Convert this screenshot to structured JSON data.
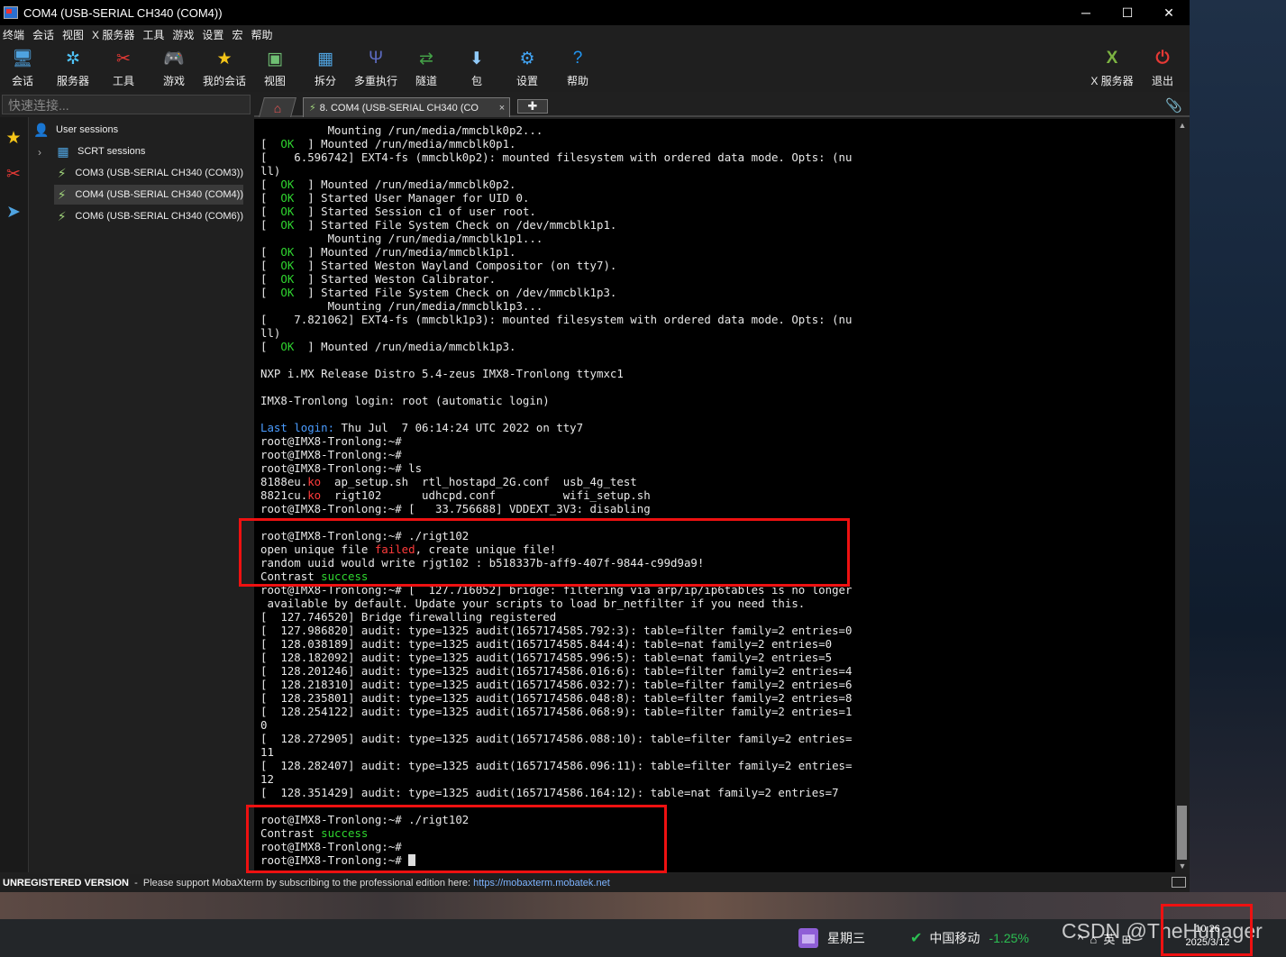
{
  "window": {
    "title": "COM4  (USB-SERIAL CH340 (COM4))",
    "controls": {
      "minimize": "─",
      "maximize": "☐",
      "close": "✕"
    }
  },
  "menu": [
    "终端",
    "会话",
    "视图",
    "X 服务器",
    "工具",
    "游戏",
    "设置",
    "宏",
    "帮助"
  ],
  "toolbar": {
    "left": [
      {
        "label": "会话",
        "icon": "monitor-icon",
        "glyph": "🖥",
        "color": "#4fa3e0"
      },
      {
        "label": "服务器",
        "icon": "servers-icon",
        "glyph": "✲",
        "color": "#4fc3f7"
      },
      {
        "label": "工具",
        "icon": "tools-icon",
        "glyph": "✂",
        "color": "#e53935"
      },
      {
        "label": "游戏",
        "icon": "gamepad-icon",
        "glyph": "🎮",
        "color": "#dddddd"
      },
      {
        "label": "我的会话",
        "icon": "star-icon",
        "glyph": "★",
        "color": "#f5c518"
      },
      {
        "label": "视图",
        "icon": "view-icon",
        "glyph": "▣",
        "color": "#6fbf73"
      },
      {
        "label": "拆分",
        "icon": "split-icon",
        "glyph": "▦",
        "color": "#4fa3e0"
      },
      {
        "label": "多重执行",
        "icon": "multiexec-icon",
        "glyph": "Ψ",
        "color": "#5c6bc0"
      },
      {
        "label": "隧道",
        "icon": "tunnel-icon",
        "glyph": "⇄",
        "color": "#43a047"
      },
      {
        "label": "包",
        "icon": "package-icon",
        "glyph": "⬇",
        "color": "#90caf9"
      },
      {
        "label": "设置",
        "icon": "settings-icon",
        "glyph": "⚙",
        "color": "#42a5f5"
      },
      {
        "label": "帮助",
        "icon": "help-icon",
        "glyph": "?",
        "color": "#2196f3"
      }
    ],
    "right": [
      {
        "label": "X 服务器",
        "icon": "xserver-icon",
        "glyph": "X",
        "color": "#7cb342"
      },
      {
        "label": "退出",
        "icon": "power-icon",
        "glyph": "⏻",
        "color": "#e53935"
      }
    ]
  },
  "quick_connect": {
    "placeholder": "快速连接..."
  },
  "tabs": {
    "home_glyph": "⌂",
    "session_label": "8. COM4  (USB-SERIAL CH340 (CO",
    "close_glyph": "×",
    "new_glyph": "✚",
    "clip_glyph": "📎"
  },
  "sessions": {
    "root": "User sessions",
    "folder": "SCRT sessions",
    "items": [
      {
        "label": "COM3  (USB-SERIAL CH340 (COM3))",
        "selected": false
      },
      {
        "label": "COM4  (USB-SERIAL CH340 (COM4))",
        "selected": true
      },
      {
        "label": "COM6  (USB-SERIAL CH340 (COM6))",
        "selected": false
      }
    ]
  },
  "terminal": {
    "lines": [
      [
        {
          "t": "          Mounting /run/media/mmcblk0p2..."
        }
      ],
      [
        {
          "t": "[  "
        },
        {
          "t": "OK",
          "c": "ok"
        },
        {
          "t": "  ] Mounted /run/media/mmcblk0p1."
        }
      ],
      [
        {
          "t": "[    6.596742] EXT4-fs (mmcblk0p2): mounted filesystem with ordered data mode. Opts: (nu"
        }
      ],
      [
        {
          "t": "ll)"
        }
      ],
      [
        {
          "t": "[  "
        },
        {
          "t": "OK",
          "c": "ok"
        },
        {
          "t": "  ] Mounted /run/media/mmcblk0p2."
        }
      ],
      [
        {
          "t": "[  "
        },
        {
          "t": "OK",
          "c": "ok"
        },
        {
          "t": "  ] Started User Manager for UID 0."
        }
      ],
      [
        {
          "t": "[  "
        },
        {
          "t": "OK",
          "c": "ok"
        },
        {
          "t": "  ] Started Session c1 of user root."
        }
      ],
      [
        {
          "t": "[  "
        },
        {
          "t": "OK",
          "c": "ok"
        },
        {
          "t": "  ] Started File System Check on /dev/mmcblk1p1."
        }
      ],
      [
        {
          "t": "          Mounting /run/media/mmcblk1p1..."
        }
      ],
      [
        {
          "t": "[  "
        },
        {
          "t": "OK",
          "c": "ok"
        },
        {
          "t": "  ] Mounted /run/media/mmcblk1p1."
        }
      ],
      [
        {
          "t": "[  "
        },
        {
          "t": "OK",
          "c": "ok"
        },
        {
          "t": "  ] Started Weston Wayland Compositor (on tty7)."
        }
      ],
      [
        {
          "t": "[  "
        },
        {
          "t": "OK",
          "c": "ok"
        },
        {
          "t": "  ] Started Weston Calibrator."
        }
      ],
      [
        {
          "t": "[  "
        },
        {
          "t": "OK",
          "c": "ok"
        },
        {
          "t": "  ] Started File System Check on /dev/mmcblk1p3."
        }
      ],
      [
        {
          "t": "          Mounting /run/media/mmcblk1p3..."
        }
      ],
      [
        {
          "t": "[    7.821062] EXT4-fs (mmcblk1p3): mounted filesystem with ordered data mode. Opts: (nu"
        }
      ],
      [
        {
          "t": "ll)"
        }
      ],
      [
        {
          "t": "[  "
        },
        {
          "t": "OK",
          "c": "ok"
        },
        {
          "t": "  ] Mounted /run/media/mmcblk1p3."
        }
      ],
      [
        {
          "t": ""
        }
      ],
      [
        {
          "t": "NXP i.MX Release Distro 5.4-zeus IMX8-Tronlong ttymxc1"
        }
      ],
      [
        {
          "t": ""
        }
      ],
      [
        {
          "t": "IMX8-Tronlong login: root (automatic login)"
        }
      ],
      [
        {
          "t": ""
        }
      ],
      [
        {
          "t": "Last login:",
          "c": "blue"
        },
        {
          "t": " Thu Jul  7 06:14:24 UTC 2022 on tty7"
        }
      ],
      [
        {
          "t": "root@IMX8-Tronlong:~#"
        }
      ],
      [
        {
          "t": "root@IMX8-Tronlong:~#"
        }
      ],
      [
        {
          "t": "root@IMX8-Tronlong:~# ls"
        }
      ],
      [
        {
          "t": "8188eu."
        },
        {
          "t": "ko",
          "c": "red"
        },
        {
          "t": "  ap_setup.sh  rtl_hostapd_2G.conf  usb_4g_test"
        }
      ],
      [
        {
          "t": "8821cu."
        },
        {
          "t": "ko",
          "c": "red"
        },
        {
          "t": "  rigt102      udhcpd.conf          wifi_setup.sh"
        }
      ],
      [
        {
          "t": "root@IMX8-Tronlong:~# [   33.756688] VDDEXT_3V3: disabling"
        }
      ],
      [
        {
          "t": ""
        }
      ],
      [
        {
          "t": "root@IMX8-Tronlong:~# ./rigt102"
        }
      ],
      [
        {
          "t": "open unique file "
        },
        {
          "t": "failed",
          "c": "red"
        },
        {
          "t": ", create unique file!"
        }
      ],
      [
        {
          "t": "random uuid would write rjgt102 : b518337b-aff9-407f-9844-c99d9a9!"
        }
      ],
      [
        {
          "t": "Contrast "
        },
        {
          "t": "success",
          "c": "green"
        }
      ],
      [
        {
          "t": "root@IMX8-Tronlong:~# [  127.716052] bridge: filtering via arp/ip/ip6tables is no longer"
        }
      ],
      [
        {
          "t": " available by default. Update your scripts to load br_netfilter if you need this."
        }
      ],
      [
        {
          "t": "[  127.746520] Bridge firewalling registered"
        }
      ],
      [
        {
          "t": "[  127.986820] audit: type=1325 audit(1657174585.792:3): table=filter family=2 entries=0"
        }
      ],
      [
        {
          "t": "[  128.038189] audit: type=1325 audit(1657174585.844:4): table=nat family=2 entries=0"
        }
      ],
      [
        {
          "t": "[  128.182092] audit: type=1325 audit(1657174585.996:5): table=nat family=2 entries=5"
        }
      ],
      [
        {
          "t": "[  128.201246] audit: type=1325 audit(1657174586.016:6): table=filter family=2 entries=4"
        }
      ],
      [
        {
          "t": "[  128.218310] audit: type=1325 audit(1657174586.032:7): table=filter family=2 entries=6"
        }
      ],
      [
        {
          "t": "[  128.235801] audit: type=1325 audit(1657174586.048:8): table=filter family=2 entries=8"
        }
      ],
      [
        {
          "t": "[  128.254122] audit: type=1325 audit(1657174586.068:9): table=filter family=2 entries=1"
        }
      ],
      [
        {
          "t": "0"
        }
      ],
      [
        {
          "t": "[  128.272905] audit: type=1325 audit(1657174586.088:10): table=filter family=2 entries="
        }
      ],
      [
        {
          "t": "11"
        }
      ],
      [
        {
          "t": "[  128.282407] audit: type=1325 audit(1657174586.096:11): table=filter family=2 entries="
        }
      ],
      [
        {
          "t": "12"
        }
      ],
      [
        {
          "t": "[  128.351429] audit: type=1325 audit(1657174586.164:12): table=nat family=2 entries=7"
        }
      ],
      [
        {
          "t": ""
        }
      ],
      [
        {
          "t": "root@IMX8-Tronlong:~# ./rigt102"
        }
      ],
      [
        {
          "t": "Contrast "
        },
        {
          "t": "success",
          "c": "green"
        }
      ],
      [
        {
          "t": "root@IMX8-Tronlong:~#"
        }
      ],
      [
        {
          "t": "root@IMX8-Tronlong:~# "
        },
        {
          "cursor": true
        }
      ]
    ]
  },
  "statusbar": {
    "bold": "UNREGISTERED VERSION",
    "text": "  -  Please support MobaXterm by subscribing to the professional edition here: ",
    "link": "https://mobaxterm.mobatek.net"
  },
  "taskbar": {
    "weekday": "星期三",
    "stock_name": "中国移动",
    "stock_change": "-1.25%",
    "tray_glyphs": "^  ⌂  英  ⊞",
    "time": "10:26",
    "date": "2025/3/12",
    "watermark": "CSDN @TheHunager"
  },
  "colors": {
    "ok": "#2fd52f",
    "error": "#ff3b3b",
    "annotation": "#e11111"
  }
}
